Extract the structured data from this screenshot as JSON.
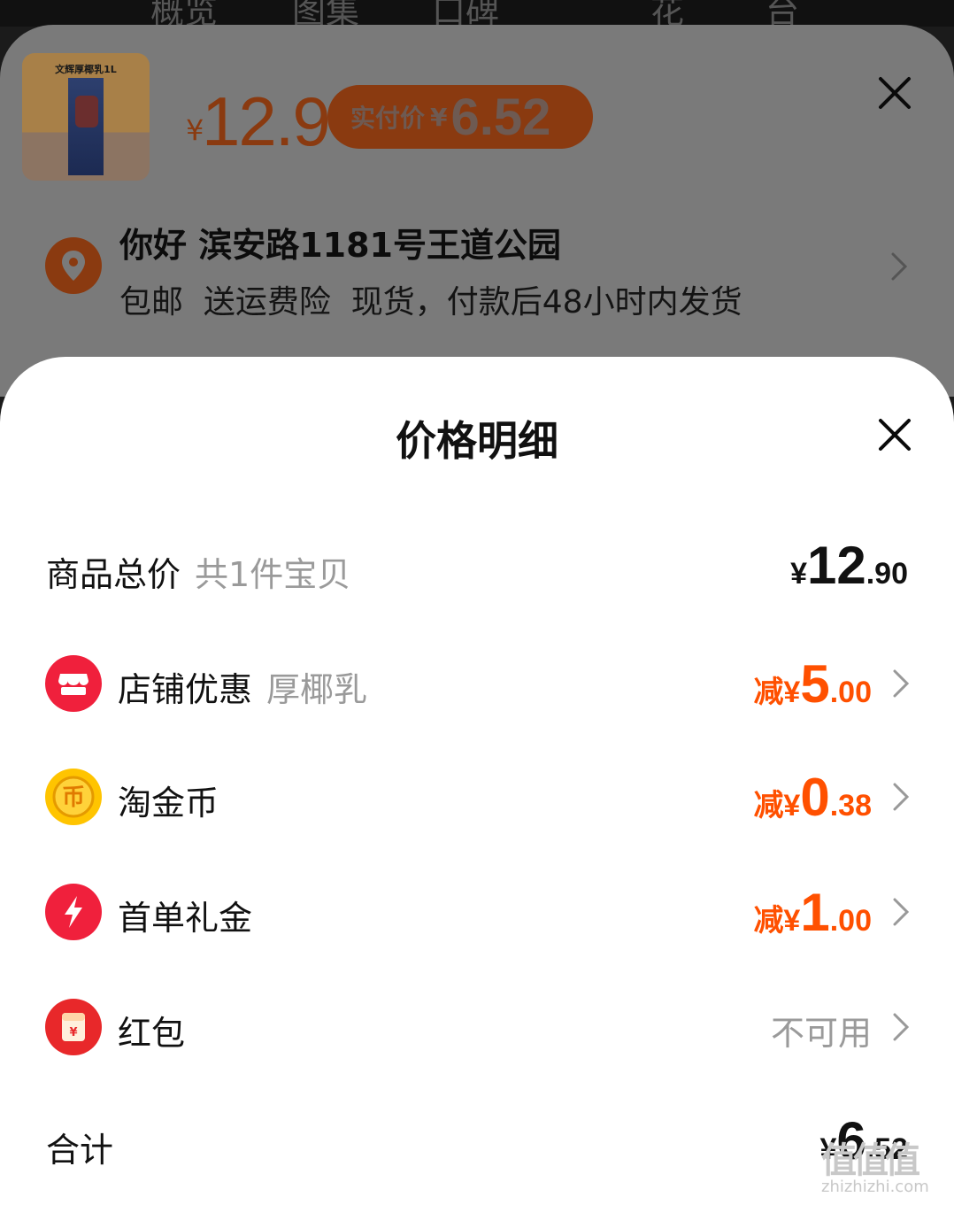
{
  "top_nav": {
    "tabs": [
      "概览",
      "图集",
      "口碑",
      "花",
      "台"
    ]
  },
  "product": {
    "thumb_text": "文辉厚椰乳1L",
    "price_symbol": "¥",
    "price": "12.9",
    "pay_label": "实付价",
    "pay_symbol": "¥",
    "pay_value": "6.52"
  },
  "address": {
    "line": "你好 滨安路1181号王道公园",
    "shipping": "包邮  送运费险  现货，付款后48小时内发货"
  },
  "sheet": {
    "title": "价格明细",
    "total_goods": {
      "label": "商品总价",
      "sub": "共1件宝贝",
      "symbol": "¥",
      "int": "12",
      "dec": ".90"
    },
    "shop_discount": {
      "label": "店铺优惠",
      "sub": "厚椰乳",
      "prefix": "减¥",
      "int": "5",
      "dec": ".00"
    },
    "coins": {
      "label": "淘金币",
      "prefix": "减¥",
      "int": "0",
      "dec": ".38"
    },
    "first_order": {
      "label": "首单礼金",
      "prefix": "减¥",
      "int": "1",
      "dec": ".00"
    },
    "red_packet": {
      "label": "红包",
      "status": "不可用"
    },
    "sum": {
      "label": "合计",
      "symbol": "¥",
      "int": "6",
      "dec": ".52"
    }
  },
  "watermark": {
    "text": "值值值",
    "sub": "zhizhizhi.com"
  },
  "colors": {
    "accent": "#ff5000",
    "shop_icon": "#f0203c",
    "coin_icon": "#ffc400",
    "red_packet": "#e8282a"
  }
}
